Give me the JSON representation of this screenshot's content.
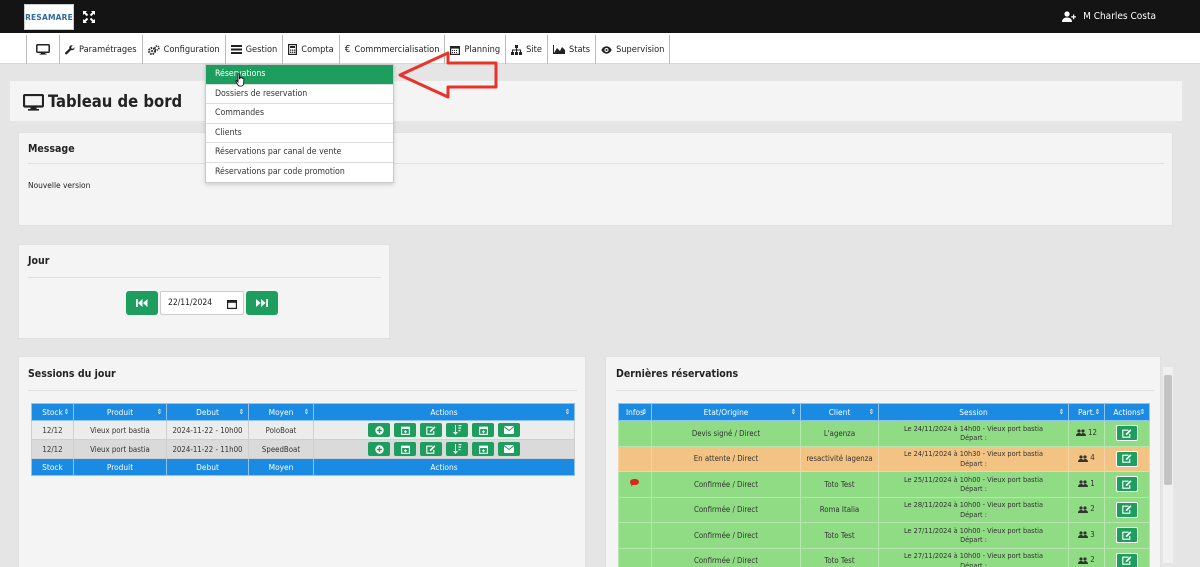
{
  "topbar": {
    "logo_text": "RESAMARE",
    "user_name": "M Charles Costa"
  },
  "nav": {
    "items": [
      {
        "label": "",
        "icon": "monitor-icon"
      },
      {
        "label": "Paramétrages",
        "icon": "wrench-icon"
      },
      {
        "label": "Configuration",
        "icon": "gears-icon"
      },
      {
        "label": "Gestion",
        "icon": "list-icon"
      },
      {
        "label": "Compta",
        "icon": "calculator-icon"
      },
      {
        "label": "Commmercialisation",
        "icon": "euro-icon"
      },
      {
        "label": "Planning",
        "icon": "calendar-icon"
      },
      {
        "label": "Site",
        "icon": "sitemap-icon"
      },
      {
        "label": "Stats",
        "icon": "area-chart-icon"
      },
      {
        "label": "Supervision",
        "icon": "eye-icon"
      }
    ]
  },
  "gestion_menu": {
    "items": [
      "Réservations",
      "Dossiers de reservation",
      "Commandes",
      "Clients",
      "Réservations par canal de vente",
      "Réservations par code promotion"
    ]
  },
  "page": {
    "title": "Tableau de bord"
  },
  "message": {
    "title": "Message",
    "body": "Nouvelle version"
  },
  "jour": {
    "title": "Jour",
    "date": "22/11/2024"
  },
  "sessions": {
    "title": "Sessions du jour",
    "columns": [
      "Stock",
      "Produit",
      "Debut",
      "Moyen",
      "Actions"
    ],
    "rows": [
      {
        "stock": "12/12",
        "produit": "Vieux port bastia",
        "debut": "2024-11-22 - 10h00",
        "moyen": "PoloBoat"
      },
      {
        "stock": "12/12",
        "produit": "Vieux port bastia",
        "debut": "2024-11-22 - 11h00",
        "moyen": "SpeedBoat"
      }
    ],
    "action_icons": [
      "plus-circle-icon",
      "calendar-plus-icon",
      "edit-icon",
      "sort-icon",
      "calendar-plus-icon",
      "envelope-icon"
    ]
  },
  "reservations": {
    "title": "Dernières réservations",
    "columns": [
      "Infos",
      "Etat/Origine",
      "Client",
      "Session",
      "Part.",
      "Actions"
    ],
    "rows": [
      {
        "info": "",
        "etat": "Devis signé / Direct",
        "client": "L'agenza",
        "session1": "Le 24/11/2024 à 14h00 - Vieux port bastia",
        "session2": "Départ :",
        "part": "12",
        "color": "green"
      },
      {
        "info": "",
        "etat": "En attente / Direct",
        "client": "resactivité lagenza",
        "session1": "Le 24/11/2024 à 10h30 - Vieux port bastia",
        "session2": "Départ :",
        "part": "4",
        "color": "orange"
      },
      {
        "info": "comment",
        "etat": "Confirmée / Direct",
        "client": "Toto Test",
        "session1": "Le 25/11/2024 à 10h00 - Vieux port bastia",
        "session2": "Départ :",
        "part": "1",
        "color": "green"
      },
      {
        "info": "",
        "etat": "Confirmée / Direct",
        "client": "Roma Italia",
        "session1": "Le 28/11/2024 à 10h00 - Vieux port bastia",
        "session2": "Départ :",
        "part": "2",
        "color": "green"
      },
      {
        "info": "",
        "etat": "Confirmée / Direct",
        "client": "Toto Test",
        "session1": "Le 27/11/2024 à 10h00 - Vieux port bastia",
        "session2": "Départ :",
        "part": "3",
        "color": "green"
      },
      {
        "info": "",
        "etat": "Confirmée / Direct",
        "client": "Toto Test",
        "session1": "Le 27/11/2024 à 10h00 - Vieux port bastia",
        "session2": "Départ :",
        "part": "2",
        "color": "green"
      }
    ]
  },
  "colors": {
    "accent_green": "#1e9e5e",
    "table_header_blue": "#1b8ae2",
    "row_green": "#8fdc84",
    "row_orange": "#f3c383",
    "annotation_arrow": "#e8322a"
  }
}
